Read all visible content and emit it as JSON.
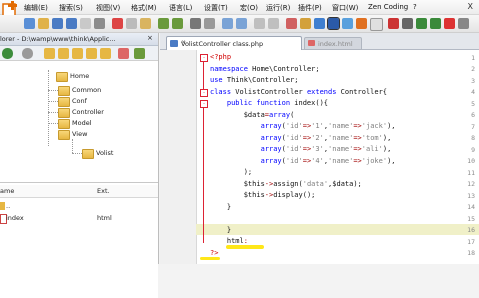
{
  "menubar": {
    "items": [
      "编辑(E)",
      "搜索(S)",
      "视图(V)",
      "格式(M)",
      "语言(L)",
      "设置(T)",
      "宏(O)",
      "运行(R)",
      "插件(P)",
      "窗口(W)",
      "Zen Coding",
      "?"
    ],
    "close": "X"
  },
  "explorer": {
    "title": "lorer - D:\\wamp\\www\\think\\Applic...",
    "close": "×",
    "tree": [
      "Home",
      "Common",
      "Conf",
      "Controller",
      "Model",
      "View",
      "Volist"
    ],
    "columns": [
      "ame",
      "Ext."
    ],
    "files": [
      {
        "name": "..",
        "ext": ""
      },
      {
        "name": "index",
        "ext": "html"
      }
    ]
  },
  "tabs": [
    {
      "label": "VolistController class.php",
      "active": true
    },
    {
      "label": "index.html",
      "active": false
    }
  ],
  "editor": {
    "line_numbers": [
      "1",
      "2",
      "3",
      "4",
      "5",
      "6",
      "7",
      "8",
      "9",
      "10",
      "11",
      "12",
      "13",
      "14",
      "15",
      "16",
      "17",
      "18"
    ]
  },
  "colors": {
    "keyword": "#0000ff",
    "php_tag": "#d00000",
    "string": "#808080",
    "highlight": "#f0f0c8"
  }
}
